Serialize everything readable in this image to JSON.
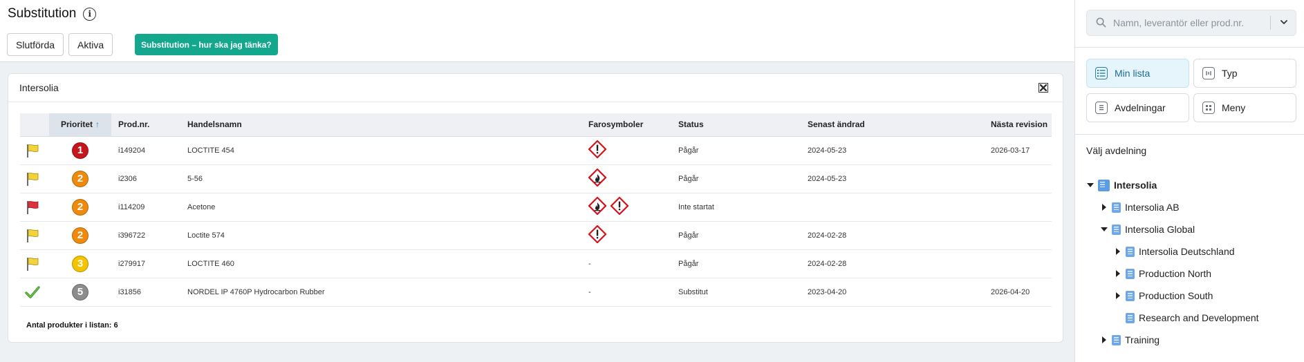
{
  "header": {
    "title": "Substitution",
    "info_icon": "info-icon",
    "buttons": {
      "completed": "Slutförda",
      "active": "Aktiva",
      "guide": "Substitution – hur ska jag tänka?"
    }
  },
  "card": {
    "title": "Intersolia",
    "export_icon": "excel-export-icon",
    "columns": {
      "priority": "Prioritet",
      "prod_nr": "Prod.nr.",
      "trade_name": "Handelsnamn",
      "hazards": "Farosymboler",
      "status": "Status",
      "last_changed": "Senast ändrad",
      "next_revision": "Nästa revision"
    },
    "rows": [
      {
        "flag": "yellow",
        "priority": "1",
        "priority_color": "#c4161c",
        "prod_nr": "i149204",
        "name": "LOCTITE 454",
        "hazards": [
          "exclamation"
        ],
        "hazard_text": "",
        "status": "Pågår",
        "last_changed": "2024-05-23",
        "next_revision": "2026-03-17"
      },
      {
        "flag": "yellow",
        "priority": "2",
        "priority_color": "#f08a0c",
        "prod_nr": "i2306",
        "name": "5-56",
        "hazards": [
          "flame"
        ],
        "hazard_text": "",
        "status": "Pågår",
        "last_changed": "2024-05-23",
        "next_revision": ""
      },
      {
        "flag": "red",
        "priority": "2",
        "priority_color": "#f08a0c",
        "prod_nr": "i114209",
        "name": "Acetone",
        "hazards": [
          "flame",
          "exclamation"
        ],
        "hazard_text": "",
        "status": "Inte startat",
        "last_changed": "",
        "next_revision": ""
      },
      {
        "flag": "yellow",
        "priority": "2",
        "priority_color": "#f08a0c",
        "prod_nr": "i396722",
        "name": "Loctite 574",
        "hazards": [
          "exclamation"
        ],
        "hazard_text": "",
        "status": "Pågår",
        "last_changed": "2024-02-28",
        "next_revision": ""
      },
      {
        "flag": "yellow",
        "priority": "3",
        "priority_color": "#f5c400",
        "prod_nr": "i279917",
        "name": "LOCTITE 460",
        "hazards": [],
        "hazard_text": "-",
        "status": "Pågår",
        "last_changed": "2024-02-28",
        "next_revision": ""
      },
      {
        "flag": "check",
        "priority": "5",
        "priority_color": "#8c8c8c",
        "prod_nr": "i31856",
        "name": "NORDEL IP 4760P Hydrocarbon Rubber",
        "hazards": [],
        "hazard_text": "-",
        "status": "Substitut",
        "last_changed": "2023-04-20",
        "next_revision": "2026-04-20"
      }
    ],
    "total_label": "Antal produkter i listan: 6"
  },
  "sidebar": {
    "search_placeholder": "Namn, leverantör eller prod.nr.",
    "tiles": {
      "my_list": "Min lista",
      "type": "Typ",
      "departments": "Avdelningar",
      "menu": "Meny"
    },
    "heading": "Välj avdelning",
    "tree": [
      {
        "label": "Intersolia",
        "state": "expanded",
        "level": 0
      },
      {
        "label": "Intersolia AB",
        "state": "collapsed",
        "level": 1
      },
      {
        "label": "Intersolia Global",
        "state": "expanded",
        "level": 1
      },
      {
        "label": "Intersolia Deutschland",
        "state": "collapsed",
        "level": 2
      },
      {
        "label": "Production North",
        "state": "collapsed",
        "level": 2
      },
      {
        "label": "Production South",
        "state": "collapsed",
        "level": 2
      },
      {
        "label": "Research and Development",
        "state": "leaf",
        "level": 2
      },
      {
        "label": "Training",
        "state": "collapsed",
        "level": 1
      }
    ]
  },
  "colors": {
    "accent_teal": "#13a88e",
    "active_tile": "#e6f4fb",
    "link_blue": "#2a8ad6"
  }
}
